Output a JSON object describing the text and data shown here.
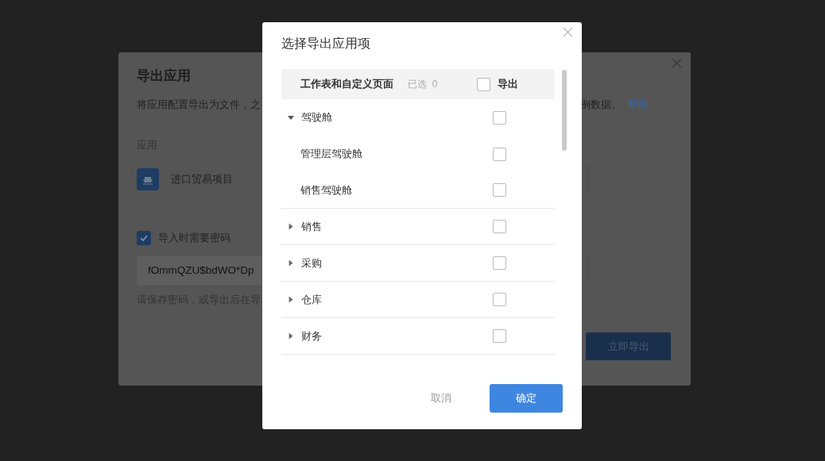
{
  "background_dialog": {
    "title": "导出应用",
    "description_left": "将应用配置导出为文件，之",
    "description_right": "例数据。",
    "help_link": "帮助",
    "app_label": "应用",
    "app_name": "进口贸易项目",
    "require_password": {
      "label": "导入时需要密码",
      "checked": true
    },
    "password": "fOmmQZU$bdWO*Dp",
    "password_hint": "请保存密码，或导出后在导",
    "export_button": "立即导出"
  },
  "modal": {
    "title": "选择导出应用项",
    "header": {
      "name": "工作表和自定义页面",
      "selected_count": "已选  0",
      "export_label": "导出",
      "checked": false
    },
    "items": [
      {
        "label": "驾驶舱",
        "expanded": true,
        "checked": false,
        "children": [
          {
            "label": "管理层驾驶舱",
            "checked": false
          },
          {
            "label": "销售驾驶舱",
            "checked": false
          }
        ]
      },
      {
        "label": "销售",
        "expanded": false,
        "checked": false
      },
      {
        "label": "采购",
        "expanded": false,
        "checked": false
      },
      {
        "label": "仓库",
        "expanded": false,
        "checked": false
      },
      {
        "label": "财务",
        "expanded": false,
        "checked": false
      }
    ],
    "cancel_button": "取消",
    "confirm_button": "确定"
  }
}
